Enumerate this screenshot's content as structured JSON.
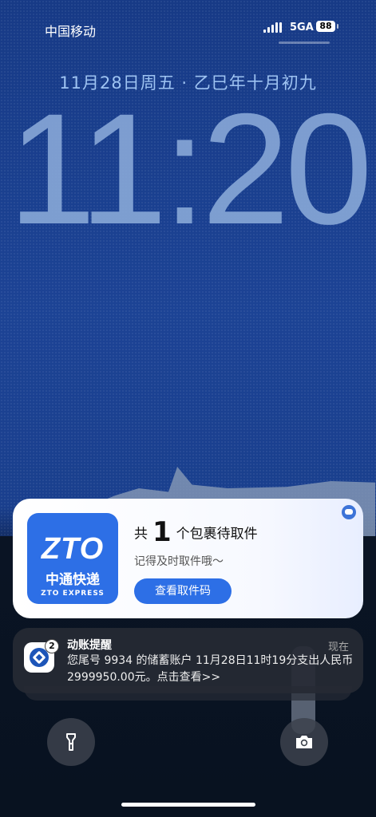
{
  "status_bar": {
    "carrier": "中国移动",
    "network": "5GA",
    "battery": "88"
  },
  "lockscreen": {
    "date": "11月28日周五 · 乙巳年十月初九",
    "time": "11:20"
  },
  "notifications": {
    "zto": {
      "logo_text": "ZTO",
      "logo_cn": "中通快递",
      "logo_en": "ZTO EXPRESS",
      "title_pre": "共",
      "count": "1",
      "title_post": "个包裹待取件",
      "subtitle": "记得及时取件哦～",
      "button_label": "查看取件码"
    },
    "bank": {
      "title": "动账提醒",
      "time": "现在",
      "badge": "2",
      "body": "您尾号 9934 的储蓄账户 11月28日11时19分支出人民币 2999950.00元。点击查看>>"
    }
  },
  "quick_actions": {
    "flashlight_icon": "flashlight-icon",
    "camera_icon": "camera-icon"
  },
  "colors": {
    "zto_blue": "#2d6fe6",
    "clock": "#86a6d6",
    "date": "#9ec3f2"
  }
}
